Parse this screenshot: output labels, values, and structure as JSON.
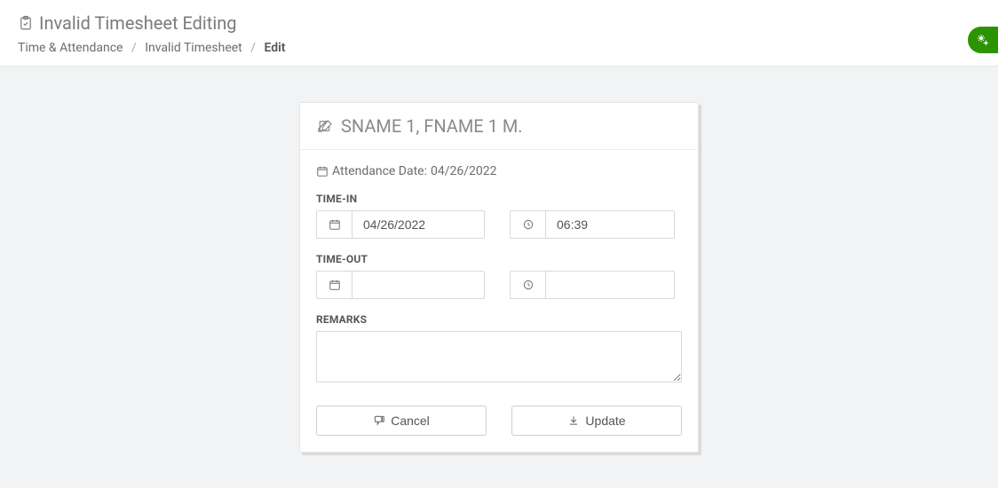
{
  "page": {
    "title": "Invalid Timesheet Editing"
  },
  "breadcrumb": {
    "item1": "Time & Attendance",
    "item2": "Invalid Timesheet",
    "current": "Edit"
  },
  "card": {
    "employee_name": "SNAME 1, FNAME 1 M.",
    "attendance_date_label": "Attendance Date:",
    "attendance_date_value": "04/26/2022"
  },
  "time_in": {
    "label": "TIME-IN",
    "date": "04/26/2022",
    "time": "06:39"
  },
  "time_out": {
    "label": "TIME-OUT",
    "date": "",
    "time": ""
  },
  "remarks": {
    "label": "REMARKS",
    "value": ""
  },
  "buttons": {
    "cancel": "Cancel",
    "update": "Update"
  }
}
